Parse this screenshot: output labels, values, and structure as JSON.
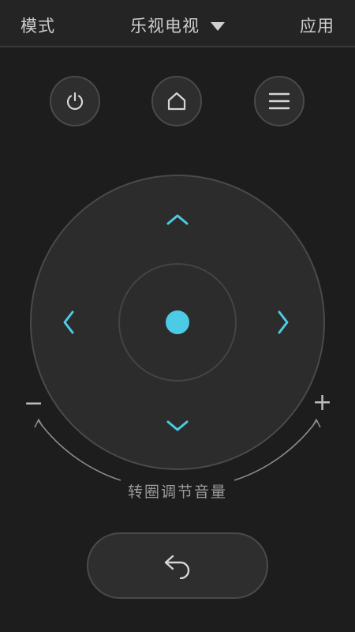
{
  "header": {
    "mode_label": "模式",
    "device_label": "乐视电视",
    "apps_label": "应用"
  },
  "controls": {
    "power_icon": "power-icon",
    "home_icon": "home-icon",
    "menu_icon": "menu-icon",
    "back_icon": "back-icon"
  },
  "volume": {
    "minus": "−",
    "plus": "+",
    "hint": "转圈调节音量"
  },
  "colors": {
    "accent": "#4ccbe6",
    "background": "#1d1d1d",
    "button": "#2e2e2e"
  }
}
